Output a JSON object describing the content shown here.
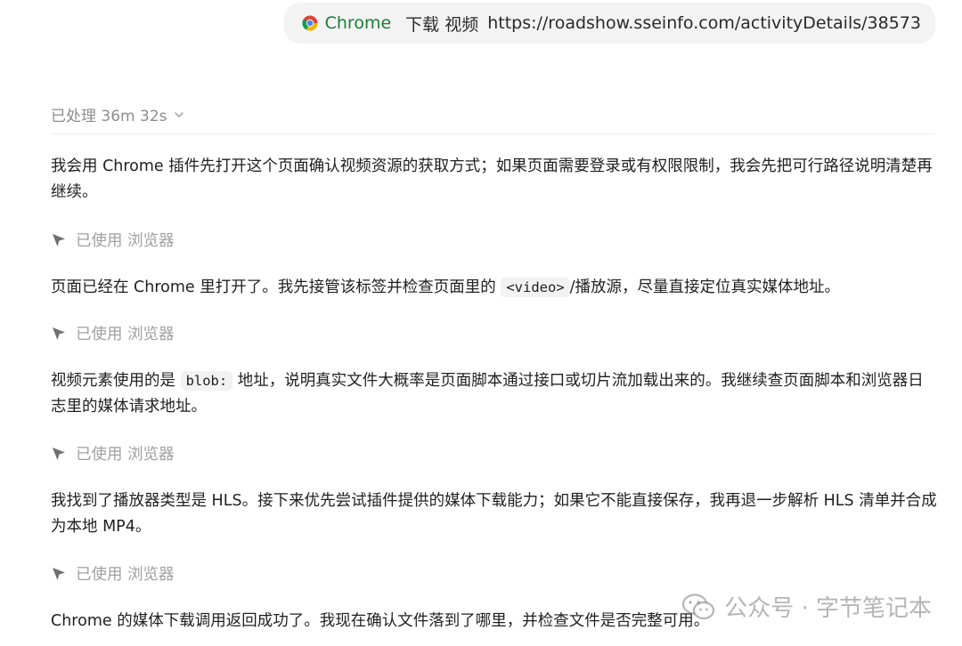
{
  "prompt": {
    "app_label": "Chrome",
    "text": "下载 视频",
    "url": "https://roadshow.sseinfo.com/activityDetails/38573",
    "chrome_icon": "chrome-icon"
  },
  "status": {
    "processed": "已处理 36m 32s"
  },
  "messages": [
    {
      "text": "我会用 Chrome 插件先打开这个页面确认视频资源的获取方式；如果页面需要登录或有权限限制，我会先把可行路径说明清楚再继续。"
    },
    {
      "text_before": "页面已经在 Chrome 里打开了。我先接管该标签并检查页面里的 ",
      "code": "<video>",
      "text_after": "/播放源，尽量直接定位真实媒体地址。"
    },
    {
      "text_before": "视频元素使用的是 ",
      "code": "blob:",
      "text_after": " 地址，说明真实文件大概率是页面脚本通过接口或切片流加载出来的。我继续查页面脚本和浏览器日志里的媒体请求地址。"
    },
    {
      "text": "我找到了播放器类型是 HLS。接下来优先尝试插件提供的媒体下载能力；如果它不能直接保存，我再退一步解析 HLS 清单并合成为本地 MP4。"
    },
    {
      "text": "Chrome 的媒体下载调用返回成功了。我现在确认文件落到了哪里，并检查文件是否完整可用。"
    }
  ],
  "tool_label": "已使用 浏览器",
  "watermark": {
    "text": "公众号 · 字节笔记本"
  }
}
